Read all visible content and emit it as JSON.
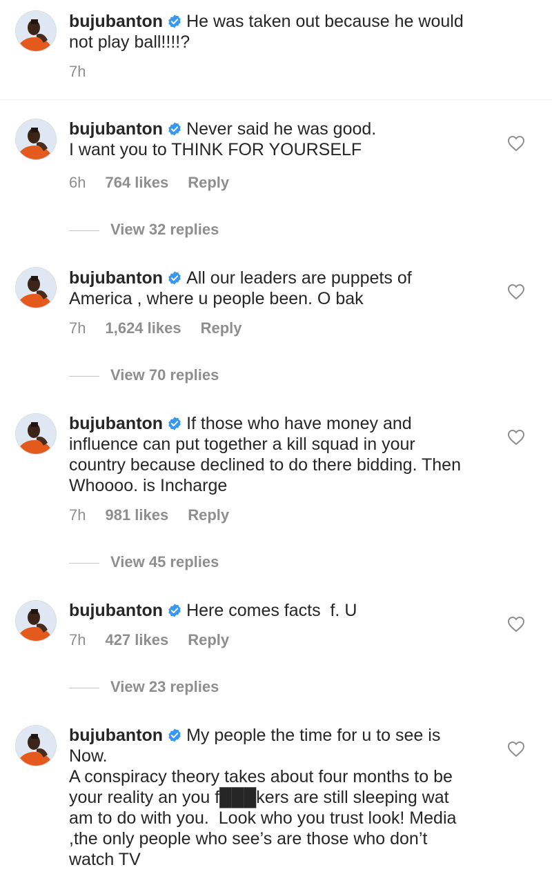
{
  "comments": [
    {
      "username": "bujubanton",
      "text": "He was taken out because he would not play ball!!!!?",
      "time": "7h",
      "likes": "",
      "reply": "",
      "view_replies": ""
    },
    {
      "username": "bujubanton",
      "text": "Never said he was good.\nI want you to THINK FOR YOURSELF",
      "time": "6h",
      "likes": "764 likes",
      "reply": "Reply",
      "view_replies": "View 32 replies"
    },
    {
      "username": "bujubanton",
      "text": "All our leaders are puppets of America , where u people been. O bak",
      "time": "7h",
      "likes": "1,624 likes",
      "reply": "Reply",
      "view_replies": "View 70 replies"
    },
    {
      "username": "bujubanton",
      "text": "If those who have money and influence can put together a kill squad in your country because declined to do there bidding. Then Whoooo. is Incharge",
      "time": "7h",
      "likes": "981 likes",
      "reply": "Reply",
      "view_replies": "View 45 replies"
    },
    {
      "username": "bujubanton",
      "text": "Here comes facts  f. U",
      "time": "7h",
      "likes": "427 likes",
      "reply": "Reply",
      "view_replies": "View 23 replies"
    },
    {
      "username": "bujubanton",
      "text": "My people the time for u to see is Now.\nA conspiracy theory takes about four months to be your reality an you f███kers are still sleeping wat am to do with you.  Look who you trust look! Media ,the only people who see’s are those who don’t watch TV",
      "time": "",
      "likes": "",
      "reply": "",
      "view_replies": ""
    }
  ],
  "icons": {
    "verified": "verified-badge-icon",
    "like": "heart-outline-icon"
  },
  "colors": {
    "verified_blue": "#3897f0",
    "secondary_text": "#8e8e8e"
  }
}
